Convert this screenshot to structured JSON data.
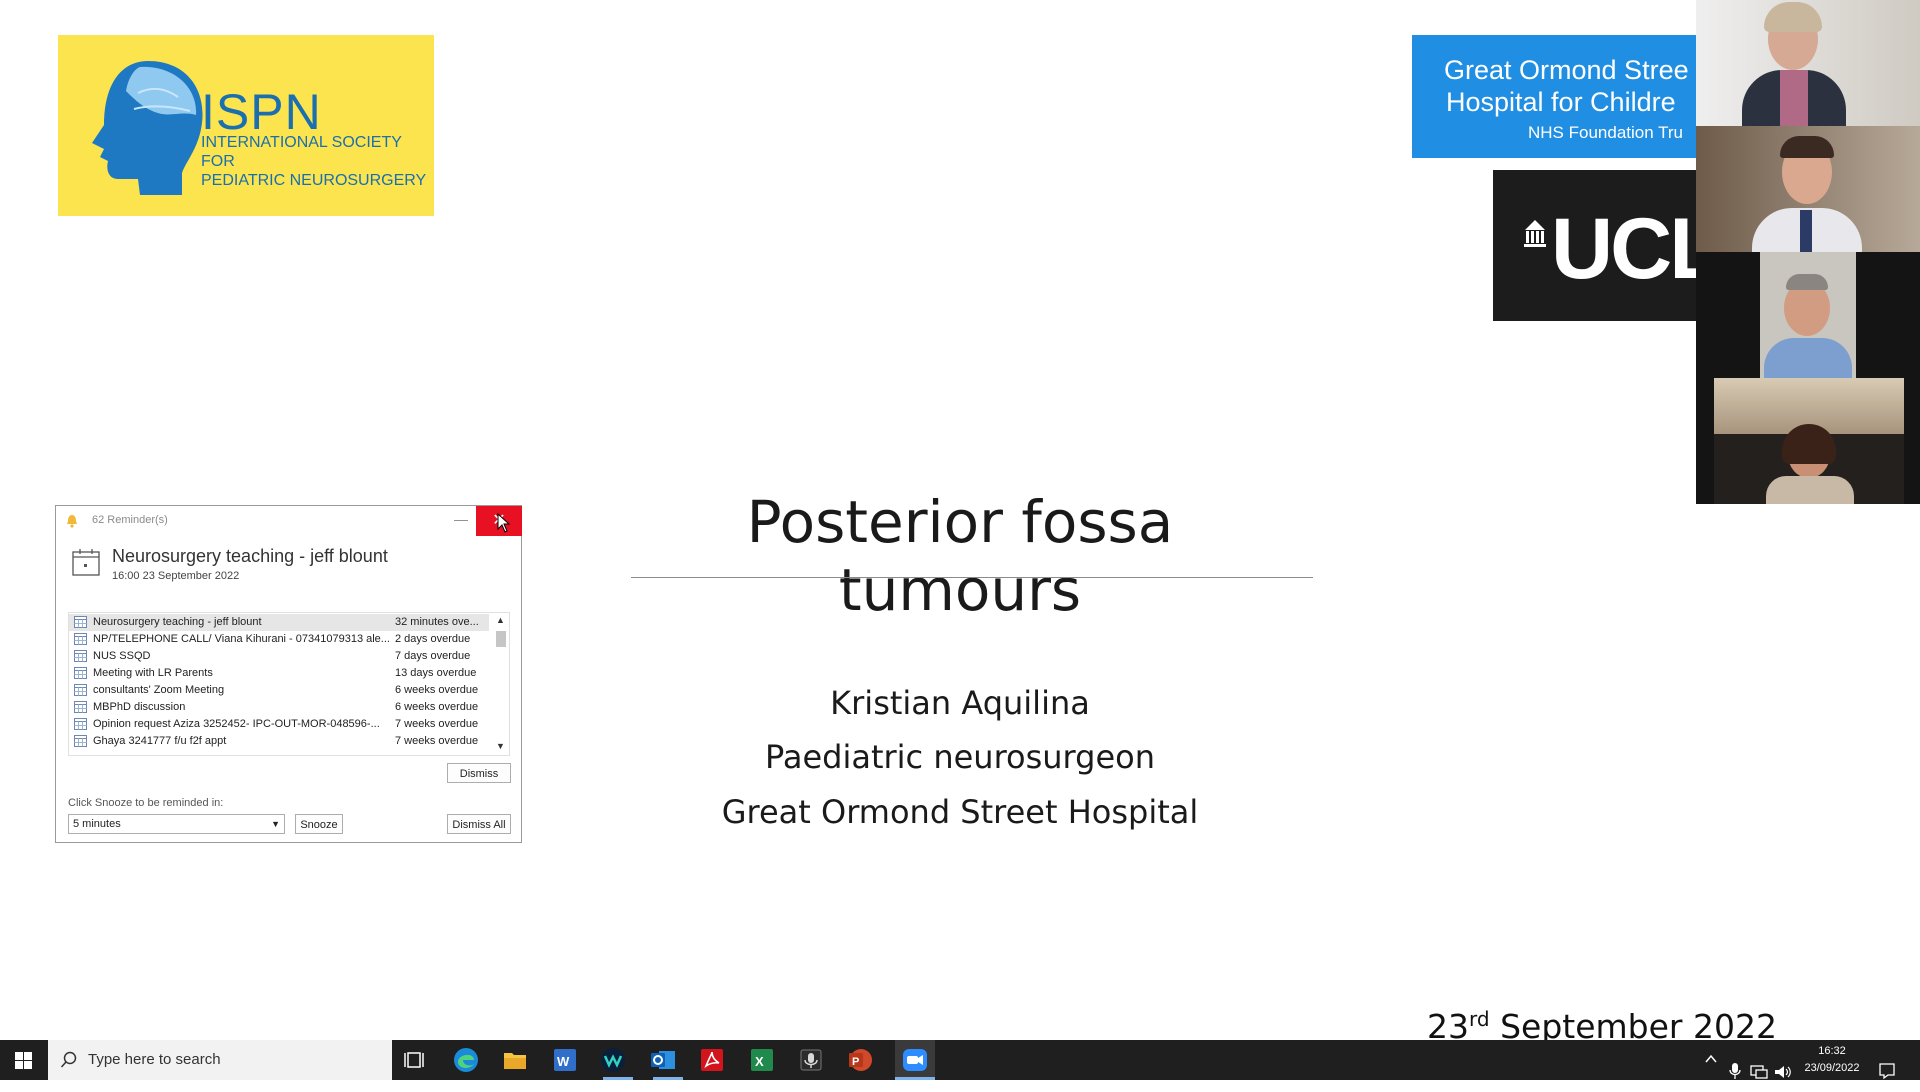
{
  "slide": {
    "title": "Posterior fossa tumours",
    "author_name": "Kristian Aquilina",
    "author_role": "Paediatric neurosurgeon",
    "author_org": "Great Ormond Street Hospital",
    "date_day": "23",
    "date_suffix": "rd",
    "date_rest": " September 2022",
    "logos": {
      "ispn_name": "ISPN",
      "ispn_sub_line1": "INTERNATIONAL SOCIETY FOR",
      "ispn_sub_line2": "PEDIATRIC NEUROSURGERY",
      "gosh_line1": "Great Ormond Stree",
      "gosh_line2": "Hospital for Childre",
      "gosh_line3": "NHS Foundation Tru",
      "ucl_text": "UCL"
    }
  },
  "reminder_window": {
    "title": "62 Reminder(s)",
    "close_glyph": "✕",
    "minimize_glyph": "—",
    "current_subject": "Neurosurgery teaching - jeff blount",
    "current_when": "16:00 23 September 2022",
    "items": [
      {
        "subject": "Neurosurgery teaching - jeff blount",
        "due": "32 minutes ove..."
      },
      {
        "subject": "NP/TELEPHONE CALL/ Viana Kihurani - 07341079313 ale...",
        "due": "2 days overdue"
      },
      {
        "subject": "NUS SSQD",
        "due": "7 days overdue"
      },
      {
        "subject": "Meeting with LR Parents",
        "due": "13 days overdue"
      },
      {
        "subject": "consultants' Zoom Meeting",
        "due": "6 weeks overdue"
      },
      {
        "subject": "MBPhD discussion",
        "due": "6 weeks overdue"
      },
      {
        "subject": "Opinion request Aziza 3252452- IPC-OUT-MOR-048596-...",
        "due": "7 weeks overdue"
      },
      {
        "subject": "Ghaya 3241777 f/u f2f appt",
        "due": "7 weeks overdue"
      }
    ],
    "dismiss_label": "Dismiss",
    "snooze_prompt": "Click Snooze to be reminded in:",
    "snooze_value": "5 minutes",
    "snooze_label": "Snooze",
    "dismiss_all_label": "Dismiss All"
  },
  "taskbar": {
    "search_placeholder": "Type here to search",
    "time": "16:32",
    "date": "23/09/2022"
  },
  "colors": {
    "accent_close": "#e81123",
    "ispn_yellow": "#fbe44e",
    "gosh_blue": "#1f8ee3",
    "taskbar": "#1f1f1f"
  }
}
